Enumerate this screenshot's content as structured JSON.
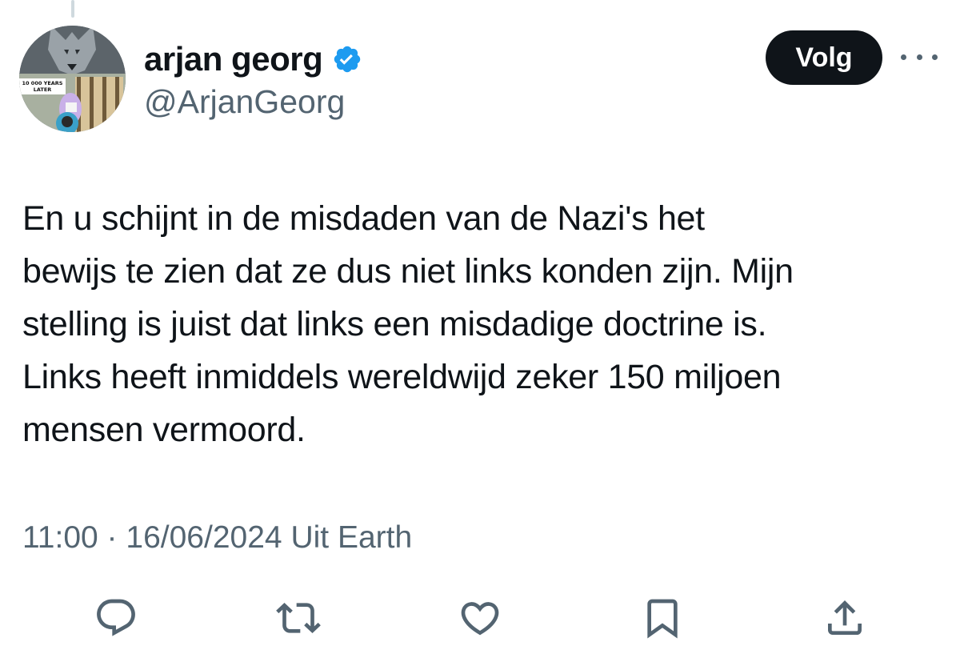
{
  "author": {
    "display_name": "arjan georg",
    "handle": "@ArjanGeorg",
    "verified": true,
    "avatar_text": "10 000 YEARS LATER"
  },
  "follow_button": {
    "label": "Volg"
  },
  "tweet": {
    "text": "En u schijnt in de misdaden van de Nazi's het\nbewijs te zien dat ze dus niet links konden zijn. Mijn\nstelling is juist dat links een misdadige doctrine is.\nLinks heeft inmiddels wereldwijd zeker 150 miljoen\nmensen vermoord.",
    "time": "11:00",
    "separator": "·",
    "date": "16/06/2024",
    "location": "Uit Earth"
  },
  "actions": [
    {
      "name": "reply",
      "icon": "reply-icon"
    },
    {
      "name": "retweet",
      "icon": "retweet-icon"
    },
    {
      "name": "like",
      "icon": "heart-icon"
    },
    {
      "name": "bookmark",
      "icon": "bookmark-icon"
    },
    {
      "name": "share",
      "icon": "share-icon"
    }
  ],
  "colors": {
    "text": "#0f1419",
    "secondary": "#536471",
    "verified": "#1d9bf0",
    "button_bg": "#0f1419",
    "button_text": "#ffffff"
  }
}
